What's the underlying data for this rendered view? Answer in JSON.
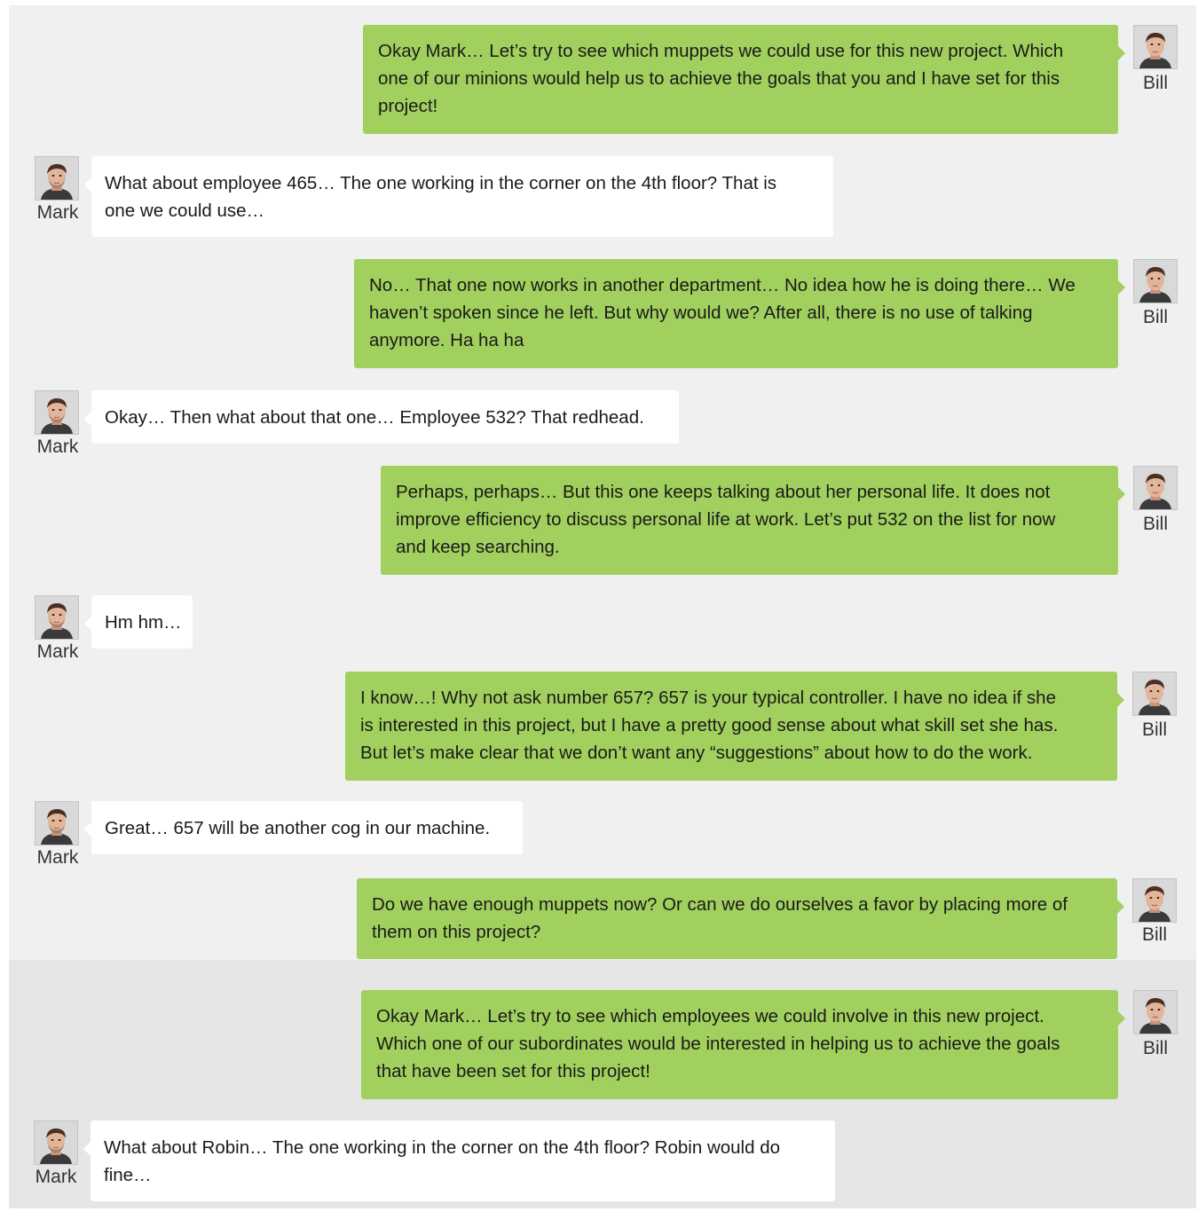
{
  "messages": [
    {
      "sender": "Bill",
      "lines": [
        "Okay Mark… Let’s try to see which muppets we could use for this new project. Which",
        "one of our minions would help us to achieve the goals that you and I have set for this",
        "project!"
      ]
    },
    {
      "sender": "Mark",
      "lines": [
        "What about employee 465… The one working in the corner on the 4th floor? That is",
        "one we could use…"
      ]
    },
    {
      "sender": "Bill",
      "lines": [
        "No… That one now works in another department… No idea how he is doing there… We",
        "haven’t spoken since he left. But why would we? After all, there is no use of talking",
        "anymore. Ha ha ha"
      ]
    },
    {
      "sender": "Mark",
      "lines": [
        "Okay… Then what about that one… Employee 532? That redhead."
      ]
    },
    {
      "sender": "Bill",
      "lines": [
        "Perhaps, perhaps… But this one keeps talking about her personal life. It does not",
        "improve efficiency to discuss personal life at work. Let’s put 532 on the list for now",
        "and keep searching."
      ]
    },
    {
      "sender": "Mark",
      "lines": [
        "Hm hm…"
      ]
    },
    {
      "sender": "Bill",
      "lines": [
        "I know…! Why not ask number 657? 657 is your typical controller. I have no idea if she",
        "is interested in this project, but I have a pretty good sense about what skill set she has.",
        "But let’s make clear that we don’t want any “suggestions” about how to do the work."
      ]
    },
    {
      "sender": "Mark",
      "lines": [
        "Great… 657 will be another cog in our machine."
      ]
    },
    {
      "sender": "Bill",
      "lines": [
        "Do we have enough muppets now? Or can we do ourselves a favor by placing more of",
        "them on this project?"
      ]
    },
    {
      "sender": "Bill",
      "lines": [
        "Okay Mark… Let’s try to see which employees we could involve in this new project.",
        "Which one of our subordinates would be interested in helping us to achieve the goals",
        "that have been set for this project!"
      ]
    },
    {
      "sender": "Mark",
      "lines": [
        "What about Robin… The one working in the corner on the 4th floor? Robin would do",
        "fine…"
      ]
    }
  ],
  "colors": {
    "bill_bubble": "#a1d05e",
    "mark_bubble": "#ffffff",
    "panel_background": "#f0f0f0"
  },
  "icons": {
    "avatar": "person-photo-icon"
  }
}
